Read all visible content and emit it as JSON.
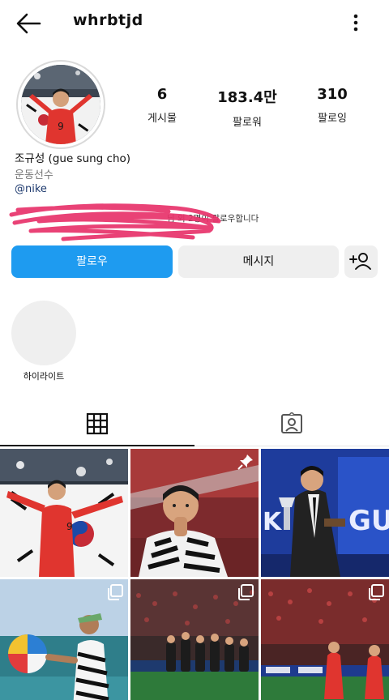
{
  "header": {
    "username": "whrbtjd",
    "back_icon": "arrow-left-icon",
    "more_icon": "more-vertical-icon"
  },
  "profile": {
    "stats": [
      {
        "value": "6",
        "label": "게시물"
      },
      {
        "value": "183.4만",
        "label": "팔로워"
      },
      {
        "value": "310",
        "label": "팔로잉"
      }
    ],
    "name": "조규성 (gue sung cho)",
    "category": "운동선수",
    "link": "@nike",
    "followed_by_visible": "님 외 2명이 팔로우합니다"
  },
  "actions": {
    "follow_label": "팔로우",
    "message_label": "메시지",
    "add_user_icon": "add-user-icon"
  },
  "highlights": [
    {
      "label": "하이라이트"
    }
  ],
  "tabs": [
    {
      "icon": "grid-icon",
      "active": true
    },
    {
      "icon": "tagged-person-icon",
      "active": false
    }
  ],
  "posts": [
    {
      "badge": ""
    },
    {
      "badge": "pin-icon"
    },
    {
      "badge": ""
    },
    {
      "badge": "multiple-images-icon"
    },
    {
      "badge": "multiple-images-icon"
    },
    {
      "badge": "multiple-images-icon"
    }
  ],
  "colors": {
    "primary_button": "#1e9bf0",
    "secondary_button": "#efefef",
    "link": "#1e3a6e",
    "scribble": "#e8336b"
  }
}
